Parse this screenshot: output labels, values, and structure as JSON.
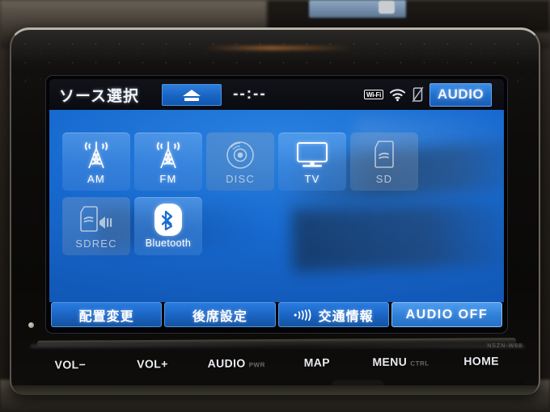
{
  "screen": {
    "header": {
      "title": "ソース選択",
      "eject_icon": "eject-icon",
      "clock": "--:--",
      "status": {
        "wifi_badge": "Wi-Fi",
        "wifi_signal_icon": "wifi-signal-icon",
        "device_disconnected_icon": "phone-off-icon"
      },
      "audio_button": "AUDIO"
    },
    "sources": [
      {
        "id": "am",
        "label": "AM",
        "icon": "radio-tower-icon",
        "enabled": true
      },
      {
        "id": "fm",
        "label": "FM",
        "icon": "radio-tower-icon",
        "enabled": true
      },
      {
        "id": "disc",
        "label": "DISC",
        "icon": "compact-disc-icon",
        "enabled": false
      },
      {
        "id": "tv",
        "label": "TV",
        "icon": "television-icon",
        "enabled": true
      },
      {
        "id": "sd",
        "label": "SD",
        "icon": "sd-card-icon",
        "enabled": false
      },
      {
        "id": "sdrec",
        "label": "SDREC",
        "icon": "sd-record-icon",
        "enabled": false
      },
      {
        "id": "bluetooth",
        "label": "Bluetooth",
        "icon": "bluetooth-icon",
        "enabled": true
      }
    ],
    "footer_buttons": [
      {
        "id": "layout-change",
        "label": "配置変更",
        "icon": null,
        "accent": false
      },
      {
        "id": "rear-seat",
        "label": "後席設定",
        "icon": null,
        "accent": false
      },
      {
        "id": "traffic-info",
        "label": "交通情報",
        "icon": "broadcast-icon",
        "accent": false
      },
      {
        "id": "audio-off",
        "label": "AUDIO OFF",
        "icon": null,
        "accent": true
      }
    ]
  },
  "hardware_keys": [
    {
      "id": "vol-down",
      "label": "VOL−",
      "sub": ""
    },
    {
      "id": "vol-up",
      "label": "VOL+",
      "sub": ""
    },
    {
      "id": "audio",
      "label": "AUDIO",
      "sub": "PWR"
    },
    {
      "id": "map",
      "label": "MAP",
      "sub": ""
    },
    {
      "id": "menu",
      "label": "MENU",
      "sub": "CTRL"
    },
    {
      "id": "home",
      "label": "HOME",
      "sub": ""
    }
  ],
  "brand_mark": "NSZN-W68",
  "colors": {
    "screen_blue": "#1769cf",
    "tile_enabled": "#5a96e4",
    "tile_disabled": "#8fa4bd",
    "button_blue": "#1a63c2",
    "accent_blue": "#2f7fd8",
    "header_black": "#0a0b10",
    "text_white": "#ffffff"
  }
}
